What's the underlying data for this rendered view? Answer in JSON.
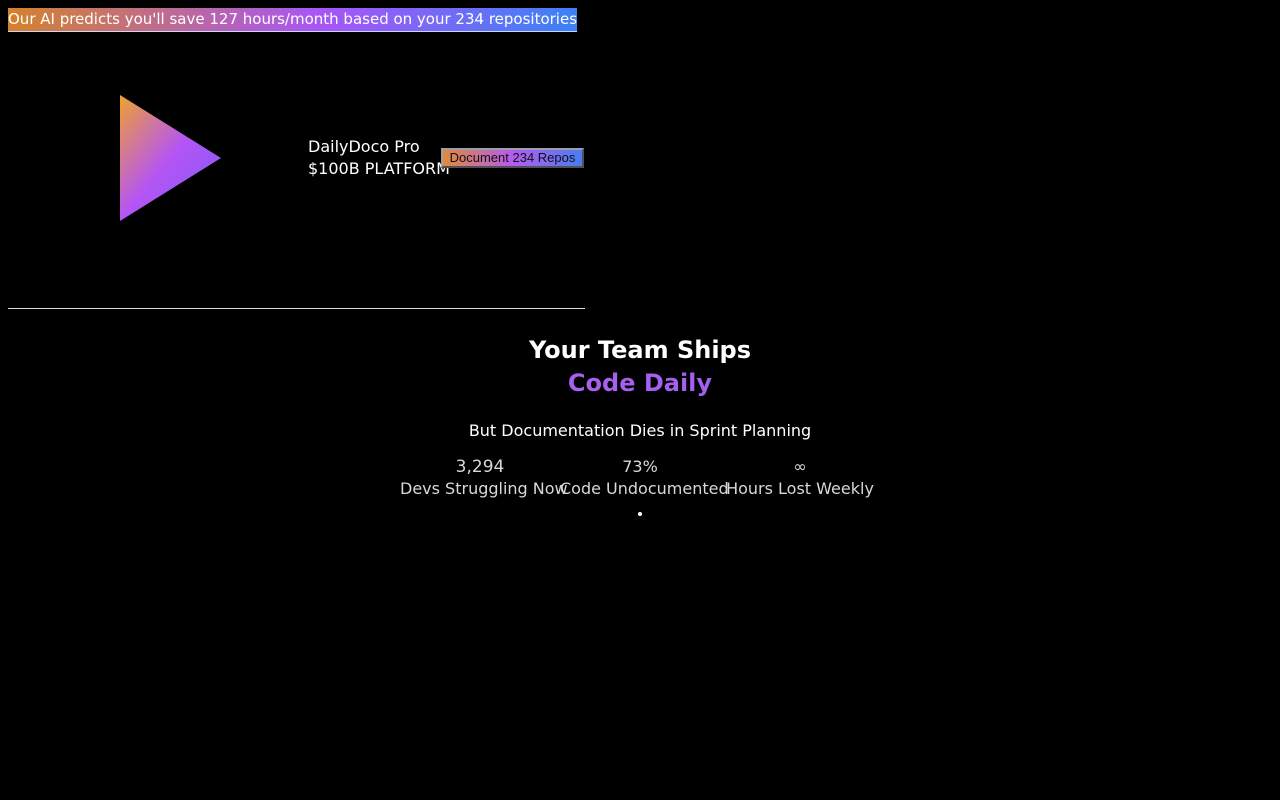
{
  "banner": {
    "text": "Our AI predicts you'll save 127 hours/month based on your 234 repositories"
  },
  "brand": {
    "logo_icon": "play-triangle-icon",
    "name": "DailyDoco Pro",
    "tagline": "$100B PLATFORM"
  },
  "cta": {
    "label": "Document 234 Repos"
  },
  "hero": {
    "title": "Your Team Ships",
    "accent": "Code Daily",
    "subtitle": "But Documentation Dies in Sprint Planning"
  },
  "stats": [
    {
      "value": "3,294",
      "label": "Devs Struggling Now"
    },
    {
      "value": "73%",
      "label": "Code Undocumented"
    },
    {
      "value": "∞",
      "label": "Hours Lost Weekly"
    }
  ],
  "colors": {
    "background": "#000000",
    "gradient_start": "#d4822a",
    "gradient_mid": "#a855f7",
    "gradient_end": "#3b82f6"
  }
}
